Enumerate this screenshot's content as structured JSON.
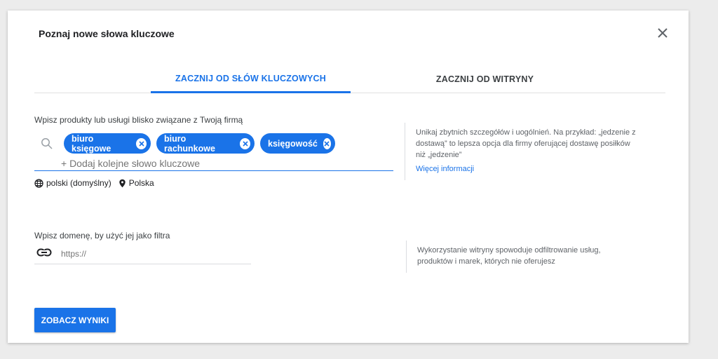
{
  "dialog": {
    "title": "Poznaj nowe słowa kluczowe"
  },
  "tabs": [
    {
      "label": "ZACZNIJ OD SŁÓW KLUCZOWYCH",
      "active": true
    },
    {
      "label": "ZACZNIJ OD WITRYNY",
      "active": false
    }
  ],
  "keywords": {
    "label": "Wpisz produkty lub usługi blisko związane z Twoją firmą",
    "chips": [
      "biuro księgowe",
      "biuro rachunkowe",
      "księgowość"
    ],
    "add_placeholder": "+ Dodaj kolejne słowo kluczowe",
    "language": "polski (domyślny)",
    "location": "Polska",
    "help_line1": "Unikaj zbytnich szczegółów i uogólnień. Na przykład: „jedzenie z",
    "help_line2": "dostawą” to lepsza opcja dla firmy oferującej dostawę posiłków",
    "help_line3": "niż „jedzenie”",
    "more_info": "Więcej informacji"
  },
  "domain": {
    "label": "Wpisz domenę, by użyć jej jako filtra",
    "placeholder": "https://",
    "help_line1": "Wykorzystanie witryny spowoduje odfiltrowanie usług,",
    "help_line2": "produktów i marek, których nie oferujesz"
  },
  "submit_label": "ZOBACZ WYNIKI",
  "colors": {
    "accent": "#1a73e8",
    "text": "#202124",
    "muted": "#5f6368"
  },
  "icons": [
    "close-icon",
    "search-icon",
    "chip-remove-icon",
    "globe-icon",
    "location-pin-icon",
    "link-icon"
  ]
}
